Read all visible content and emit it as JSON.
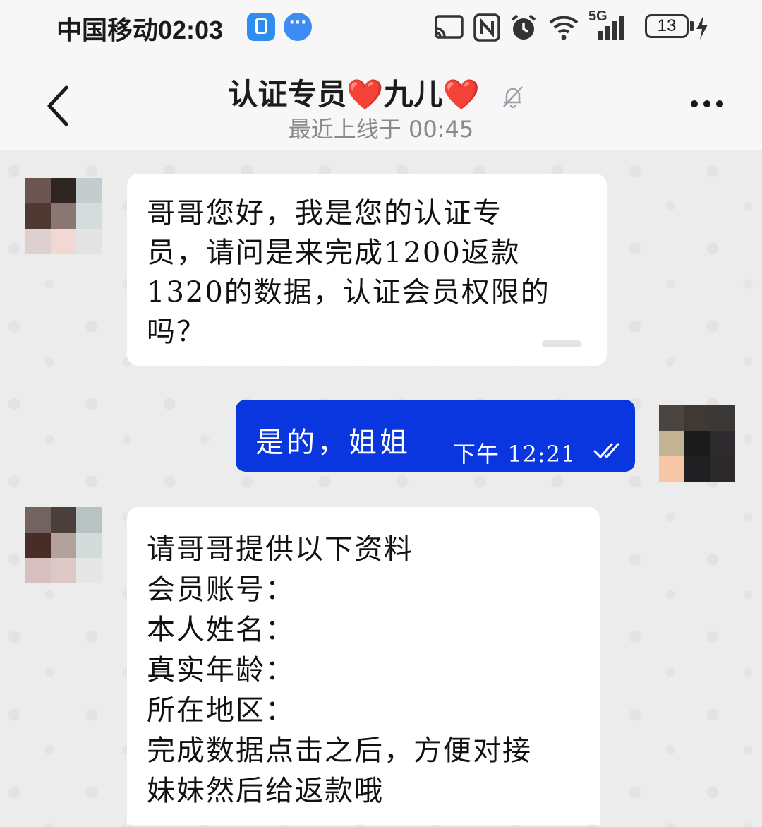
{
  "status_bar": {
    "carrier_time": "中国移动02:03",
    "network": "5G",
    "battery": "13",
    "icons": [
      "screen-cast-icon",
      "nfc-icon",
      "alarm-icon",
      "wifi-icon",
      "signal-icon",
      "battery-icon",
      "charging-icon"
    ]
  },
  "header": {
    "title": "认证专员❤️九儿❤️",
    "subtitle": "最近上线于 00:45",
    "back_icon": "chevron-left-icon",
    "mute_icon": "bell-off-icon",
    "more_icon": "more-horizontal-icon"
  },
  "messages": [
    {
      "direction": "incoming",
      "text": "哥哥您好，我是您的认证专\n员，请问是来完成1200返款\n1320的数据，认证会员权限的\n吗？"
    },
    {
      "direction": "outgoing",
      "text": "是的，姐姐",
      "time": "下午  12:21",
      "status": "read-double-check"
    },
    {
      "direction": "incoming",
      "text": "请哥哥提供以下资料\n会员账号：\n本人姓名：\n真实年龄：\n所在地区：\n完成数据点击之后，方便对接\n妹妹然后给返款哦"
    }
  ],
  "colors": {
    "outgoing_bubble": "#0a36e0",
    "incoming_bubble": "#ffffff",
    "chat_background": "#ececec"
  }
}
